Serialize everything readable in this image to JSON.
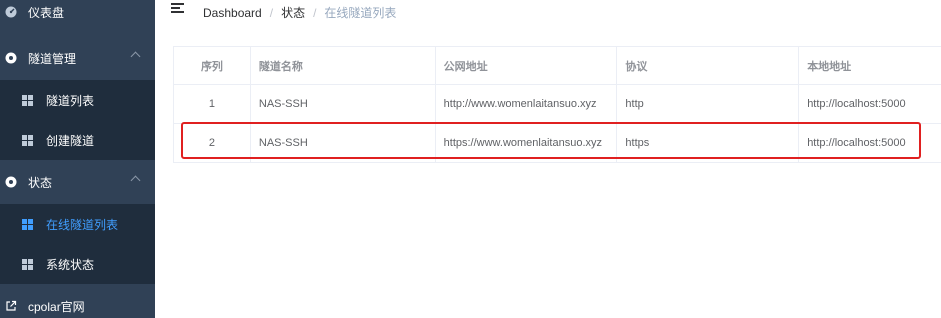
{
  "sidebar": {
    "items": [
      {
        "label": "仪表盘",
        "icon": "dashboard-icon"
      },
      {
        "label": "隧道管理",
        "icon": "tunnel-manage-icon"
      },
      {
        "label": "隧道列表",
        "icon": "grid-icon"
      },
      {
        "label": "创建隧道",
        "icon": "grid-icon"
      },
      {
        "label": "状态",
        "icon": "status-icon"
      },
      {
        "label": "在线隧道列表",
        "icon": "grid-icon"
      },
      {
        "label": "系统状态",
        "icon": "grid-icon"
      },
      {
        "label": "cpolar官网",
        "icon": "external-link-icon"
      }
    ],
    "active_color": "#409eff",
    "background": "#304156",
    "submenu_background": "#1f2d3d"
  },
  "breadcrumb": {
    "items": [
      "Dashboard",
      "状态",
      "在线隧道列表"
    ],
    "separator": "/"
  },
  "table": {
    "columns": [
      "序列",
      "隧道名称",
      "公网地址",
      "协议",
      "本地地址"
    ],
    "rows": [
      [
        "1",
        "NAS-SSH",
        "http://www.womenlaitansuo.xyz",
        "http",
        "http://localhost:5000"
      ],
      [
        "2",
        "NAS-SSH",
        "https://www.womenlaitansuo.xyz",
        "https",
        "http://localhost:5000"
      ]
    ]
  },
  "highlight_color": "#e02020"
}
